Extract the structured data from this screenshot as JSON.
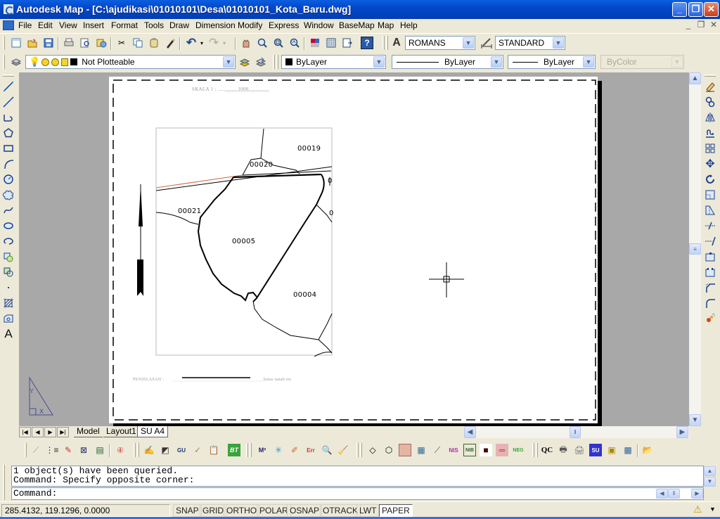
{
  "window": {
    "title": "Autodesk Map - [C:\\ajudikasi\\01010101\\Desa\\01010101_Kota_Baru.dwg]",
    "minimize_label": "_",
    "restore_label": "❐",
    "close_label": "✕"
  },
  "menu": {
    "items": [
      "File",
      "Edit",
      "View",
      "Insert",
      "Format",
      "Tools",
      "Draw",
      "Dimension",
      "Modify",
      "Express",
      "Window",
      "BaseMap",
      "Map",
      "Help"
    ],
    "doc_minimize": "_",
    "doc_restore": "❐",
    "doc_close": "✕"
  },
  "standard_toolbar": {
    "icons": [
      "new-icon",
      "open-icon",
      "save-icon",
      "plot-icon",
      "plot-preview-icon",
      "publish-icon",
      "cut-icon",
      "copy-icon",
      "paste-icon",
      "match-properties-icon",
      "undo-icon",
      "redo-icon",
      "pan-icon",
      "zoom-realtime-icon",
      "zoom-window-icon",
      "zoom-previous-icon",
      "properties-icon",
      "design-center-icon",
      "tool-palettes-icon",
      "help-icon"
    ]
  },
  "styles_toolbar": {
    "text_style": "ROMANS",
    "dim_style": "STANDARD"
  },
  "layers_toolbar": {
    "layer_name": "Not Plotteable",
    "color": "ByLayer",
    "linetype": "ByLayer",
    "lineweight": "ByLayer",
    "plot_style": "ByColor"
  },
  "layout_tabs": {
    "tabs": [
      "Model",
      "Layout1",
      "SU A4"
    ],
    "active": "SU A4"
  },
  "drawing": {
    "scale_label": "SKALA 1 : ..............1000..............",
    "legend_label": "PENJELASAN : ",
    "legend_suffix": "batas tanah ini",
    "parcels": [
      "00019",
      "00020",
      "00021",
      "00005",
      "00004"
    ],
    "partial_labels": [
      "0",
      "0"
    ],
    "ucs_labels": {
      "y": "Y",
      "x": "X"
    }
  },
  "command": {
    "history": [
      "1 object(s) have been queried.",
      "Command: Specify opposite corner:"
    ],
    "prompt": "Command:"
  },
  "status": {
    "coordinates": "285.4132, 119.1296, 0.0000",
    "toggles": [
      {
        "label": "SNAP",
        "on": false
      },
      {
        "label": "GRID",
        "on": false
      },
      {
        "label": "ORTHO",
        "on": false
      },
      {
        "label": "POLAR",
        "on": false
      },
      {
        "label": "OSNAP",
        "on": false
      },
      {
        "label": "OTRACK",
        "on": false
      },
      {
        "label": "LWT",
        "on": false
      },
      {
        "label": "PAPER",
        "on": true
      }
    ]
  },
  "bottom_toolbar": {
    "labels": {
      "bt": "BT",
      "m2": "M²",
      "nis": "NIS",
      "nib": "NIB",
      "neg": "NEG",
      "qc": "QC",
      "su": "SU",
      "err": "Err",
      "gu": "GU"
    }
  }
}
